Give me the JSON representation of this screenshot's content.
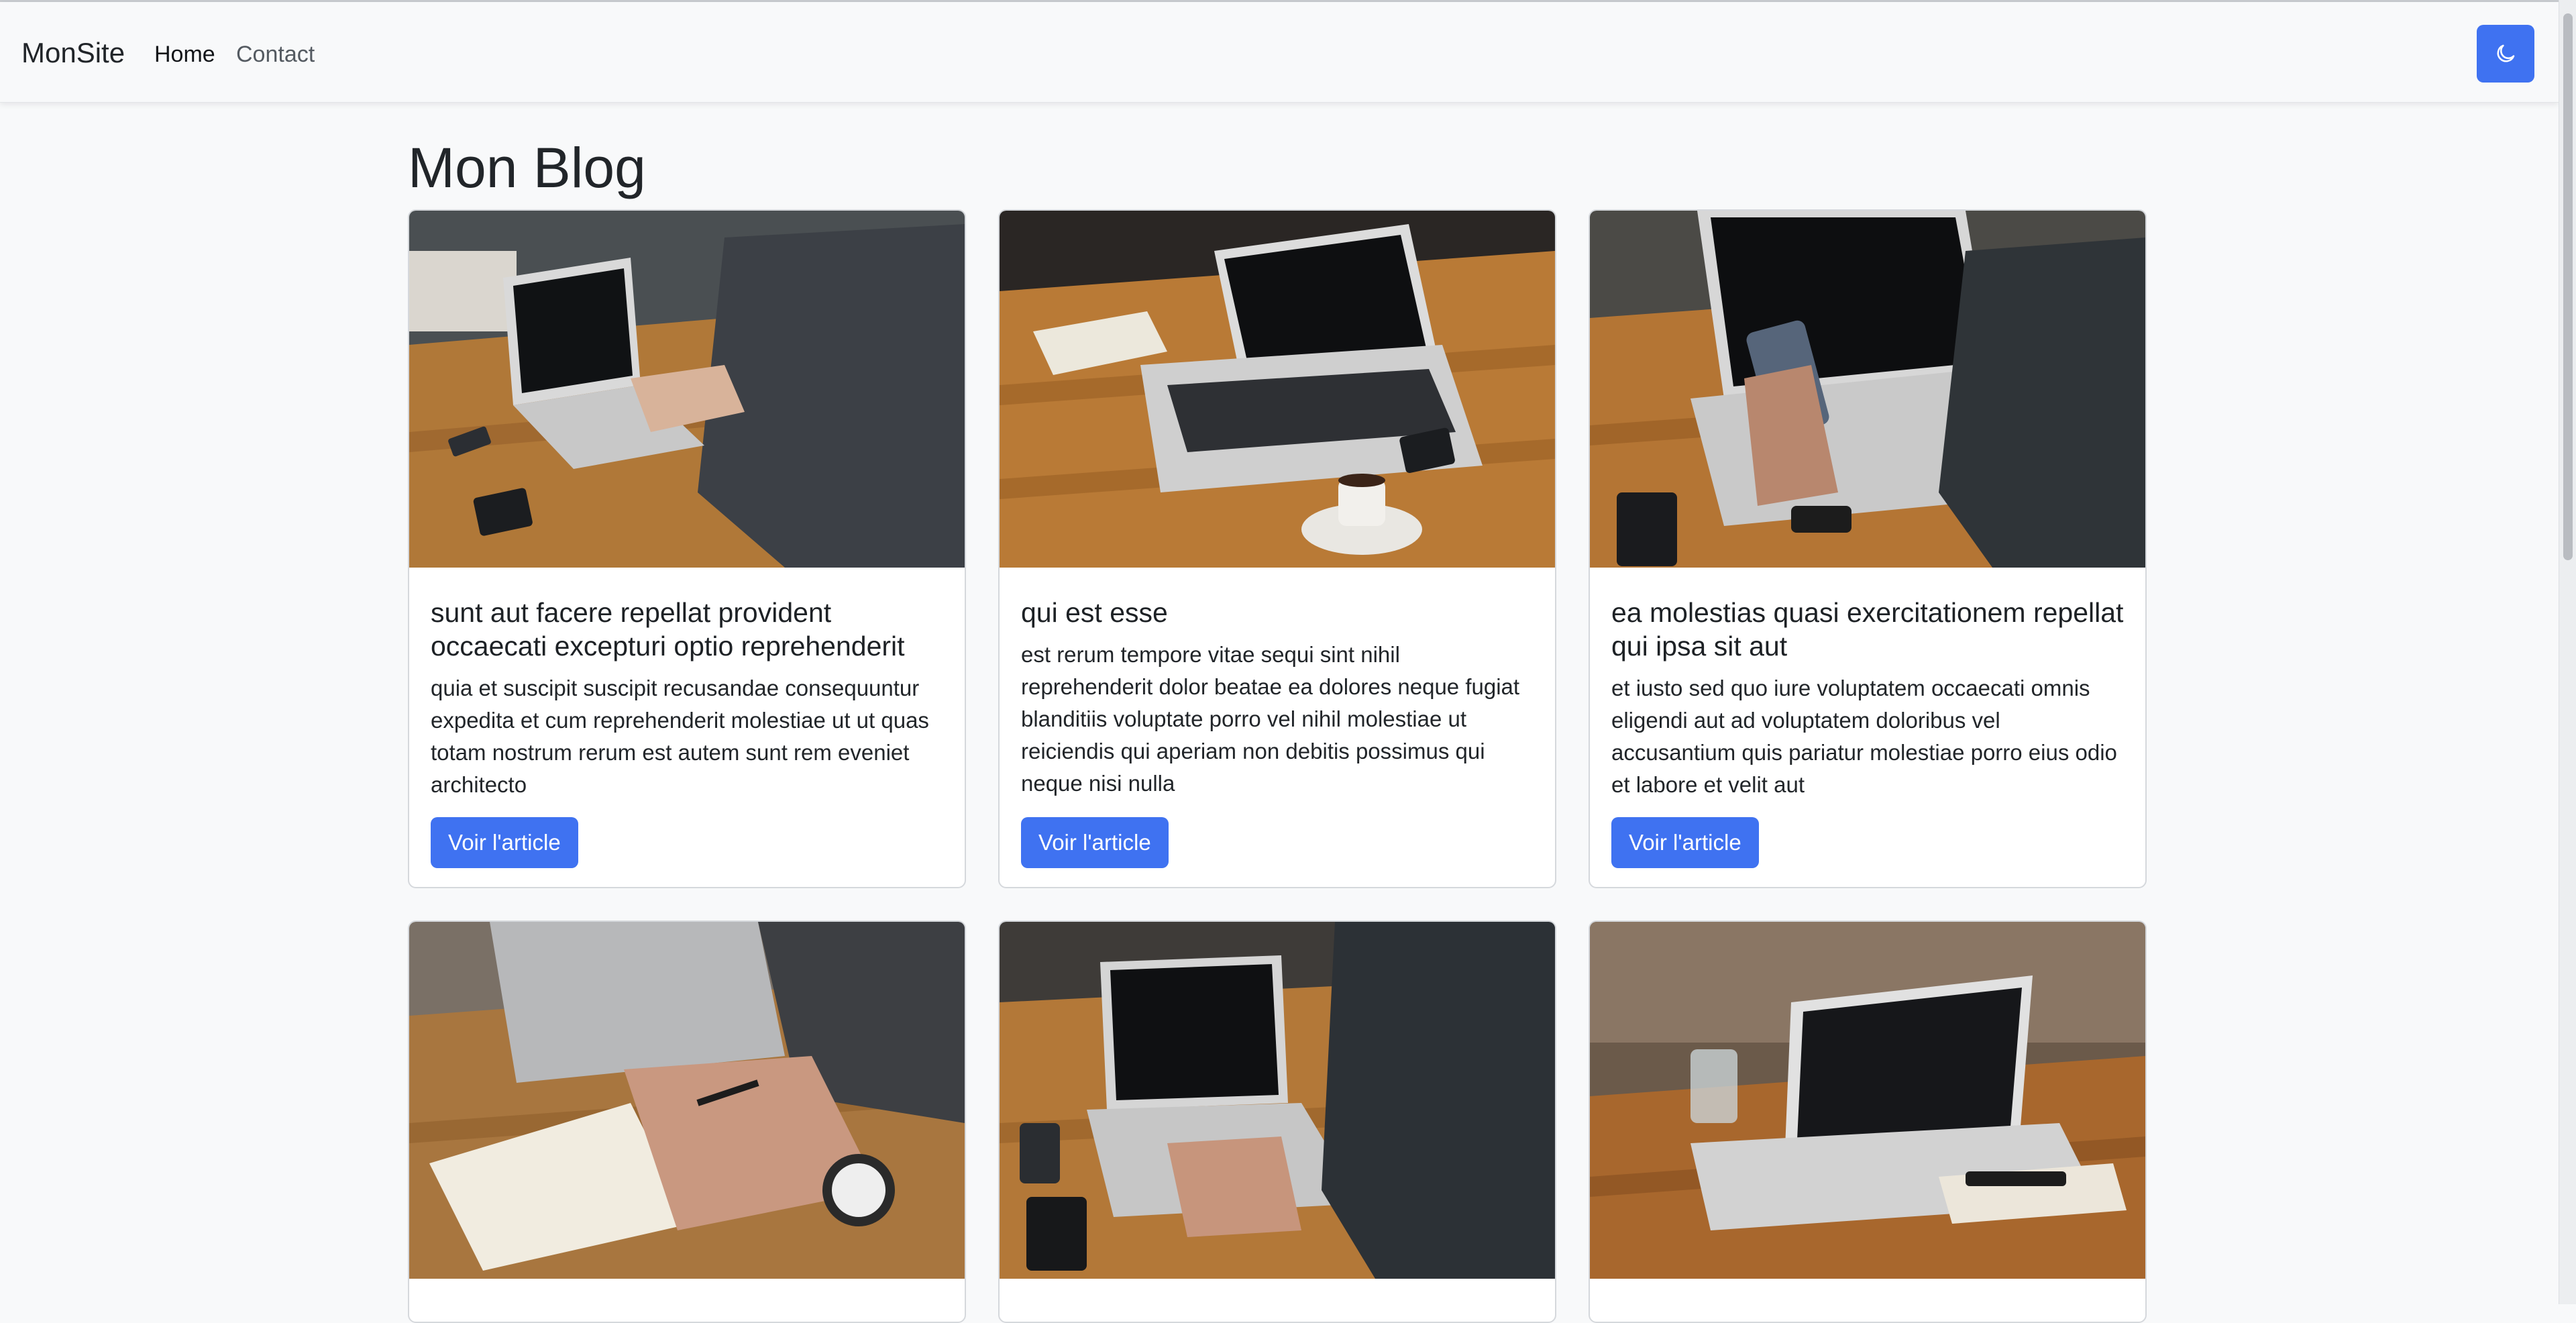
{
  "navbar": {
    "brand": "MonSite",
    "links": [
      "Home",
      "Contact"
    ],
    "theme_toggle_icon": "moon-icon",
    "accent": "#3f72f1"
  },
  "main": {
    "title": "Mon Blog",
    "read_more_label": "Voir l'article",
    "posts": [
      {
        "title": "sunt aut facere repellat provident occaecati excepturi optio reprehenderit",
        "body": "quia et suscipit suscipit recusandae consequuntur expedita et cum reprehenderit molestiae ut ut quas totam nostrum rerum est autem sunt rem eveniet architecto",
        "image_icon": "laptop-photo"
      },
      {
        "title": "qui est esse",
        "body": "est rerum tempore vitae sequi sint nihil reprehenderit dolor beatae ea dolores neque fugiat blanditiis voluptate porro vel nihil molestiae ut reiciendis qui aperiam non debitis possimus qui neque nisi nulla",
        "image_icon": "laptop-photo"
      },
      {
        "title": "ea molestias quasi exercitationem repellat qui ipsa sit aut",
        "body": "et iusto sed quo iure voluptatem occaecati omnis eligendi aut ad voluptatem doloribus vel accusantium quis pariatur molestiae porro eius odio et labore et velit aut",
        "image_icon": "phone-laptop-photo"
      }
    ]
  }
}
